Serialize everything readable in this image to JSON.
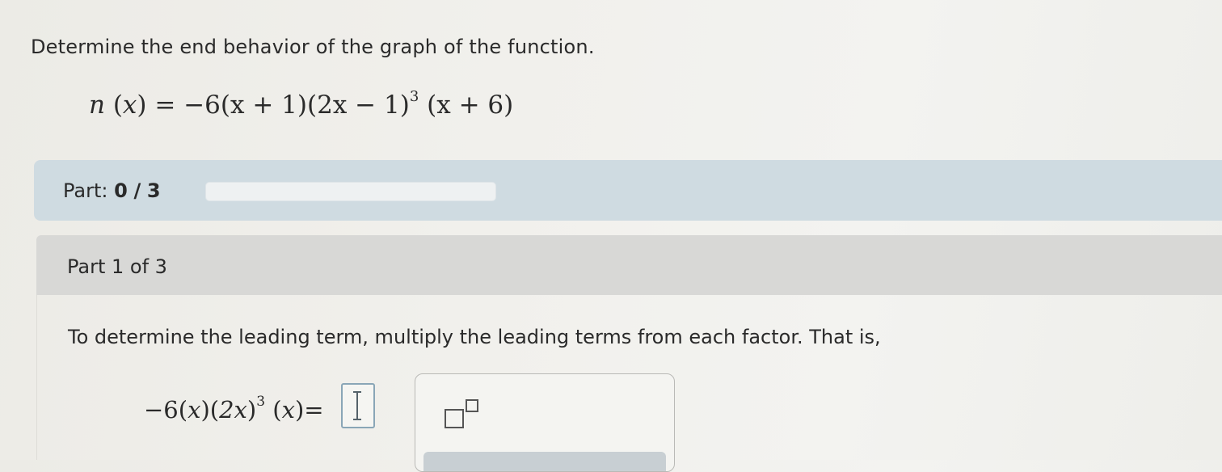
{
  "question": {
    "prompt": "Determine the end behavior of the graph of the function."
  },
  "equation": {
    "fn": "n",
    "var": "x",
    "coef": "−6",
    "factor1": "x + 1",
    "factor2": "2x − 1",
    "factor2_exp": "3",
    "factor3": "x + 6"
  },
  "part_progress": {
    "label": "Part:",
    "current": "0",
    "separator": "/",
    "total": "3",
    "fraction_complete": 0
  },
  "section": {
    "title": "Part 1 of 3",
    "instruction": "To determine the leading term, multiply the leading terms from each factor. That is,",
    "answer_expression": {
      "coef": "−6",
      "f1": "x",
      "f2": "2x",
      "f2_exp": "3",
      "f3": "x",
      "equals": "="
    }
  },
  "keypad": {
    "buttons": [
      {
        "icon": "exponent-template-icon"
      }
    ]
  }
}
